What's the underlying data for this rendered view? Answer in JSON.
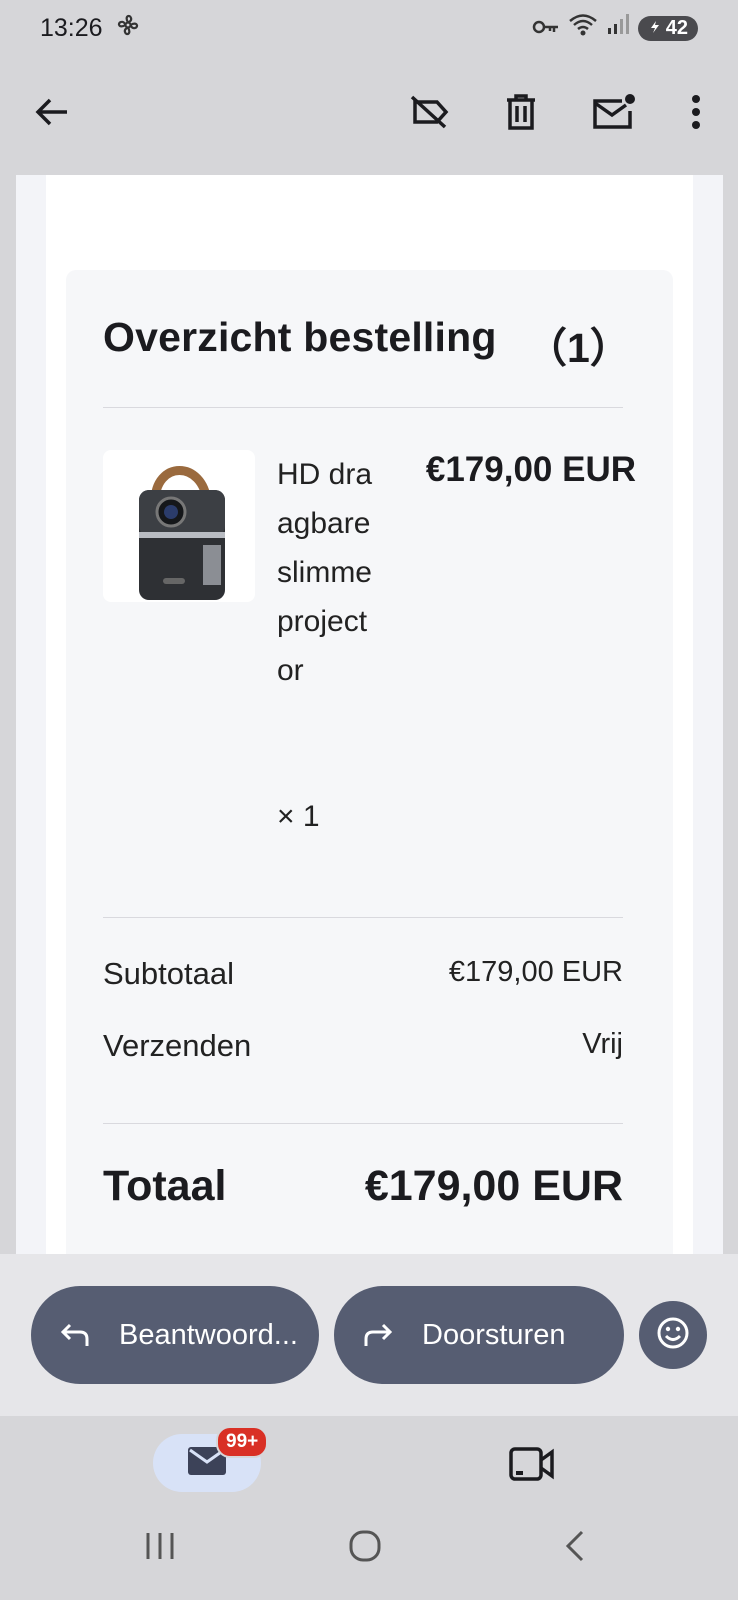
{
  "status": {
    "time": "13:26",
    "battery": "42"
  },
  "order": {
    "title": "Overzicht bestelling",
    "count": "（1）",
    "item": {
      "name": "HD draagbare slimme projector",
      "quantity": "× 1",
      "price": "€179,00 EUR"
    },
    "subtotal_label": "Subtotaal",
    "subtotal_value": "€179,00 EUR",
    "shipping_label": "Verzenden",
    "shipping_value": "Vrij",
    "total_label": "Totaal",
    "total_value": "€179,00 EUR"
  },
  "actions": {
    "reply": "Beantwoord...",
    "forward": "Doorsturen"
  },
  "nav": {
    "mail_badge": "99+"
  },
  "icons": {
    "back": "arrow-left-icon",
    "label_off": "label-off-icon",
    "delete": "trash-icon",
    "mark_unread": "mail-unread-icon",
    "more": "more-vert-icon",
    "reply": "reply-icon",
    "forward": "forward-icon",
    "emoji": "emoji-icon",
    "mail": "mail-icon",
    "video": "video-icon"
  },
  "colors": {
    "pill": "#565d72",
    "badge": "#d93025",
    "mail_tab": "#d8e2f7"
  }
}
